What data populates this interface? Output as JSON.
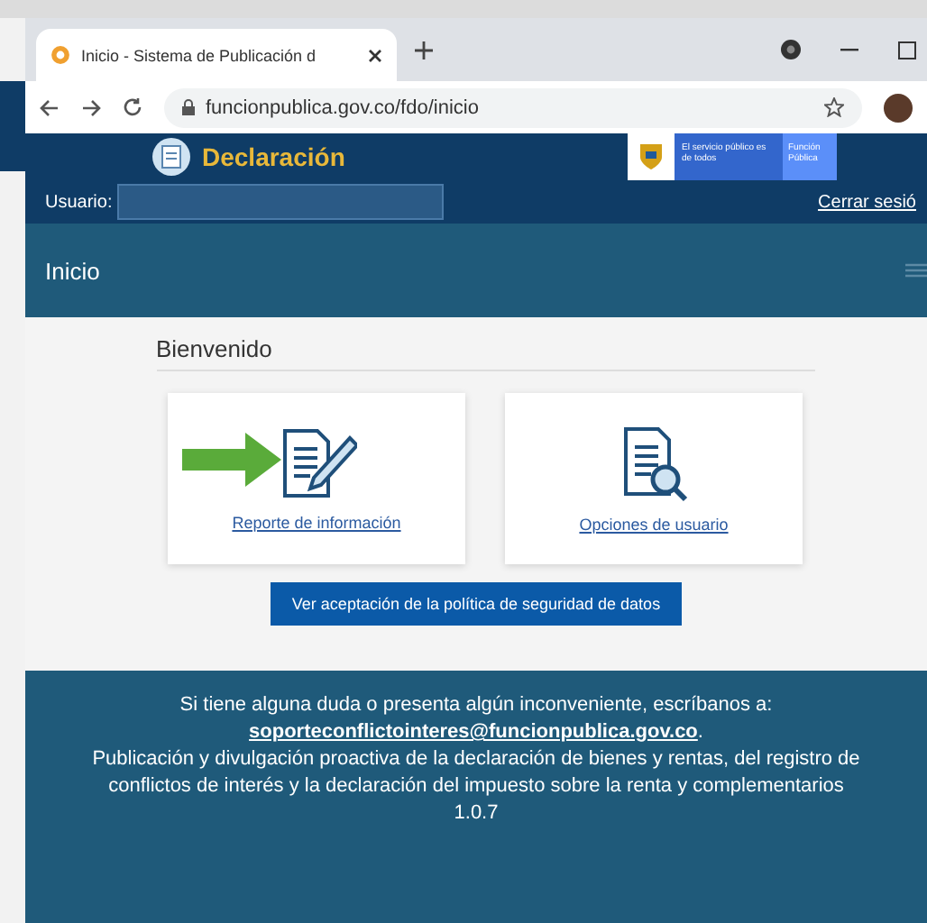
{
  "browser": {
    "tab_title": "Inicio - Sistema de Publicación d",
    "url": "funcionpublica.gov.co/fdo/inicio"
  },
  "header": {
    "app_title": "Declaración",
    "gov_text": "El servicio público es de todos",
    "entity_text": "Función Pública",
    "user_label": "Usuario:",
    "logout": "Cerrar sesió"
  },
  "nav": {
    "title": "Inicio"
  },
  "content": {
    "heading": "Bienvenido",
    "cards": [
      {
        "label": "Reporte de información",
        "kind": "report",
        "highlighted": true
      },
      {
        "label": "Opciones de usuario",
        "kind": "search",
        "highlighted": false
      }
    ],
    "policy_button": "Ver aceptación de la política de seguridad de datos"
  },
  "footer": {
    "help": "Si tiene alguna duda o presenta algún inconveniente, escríbanos a:",
    "email": "soporteconflictointeres@funcionpublica.gov.co",
    "email_suffix": ".",
    "description": "Publicación y divulgación proactiva de la declaración de bienes y rentas, del registro de conflictos de interés y la declaración del impuesto sobre la renta y complementarios",
    "version": "1.0.7"
  }
}
